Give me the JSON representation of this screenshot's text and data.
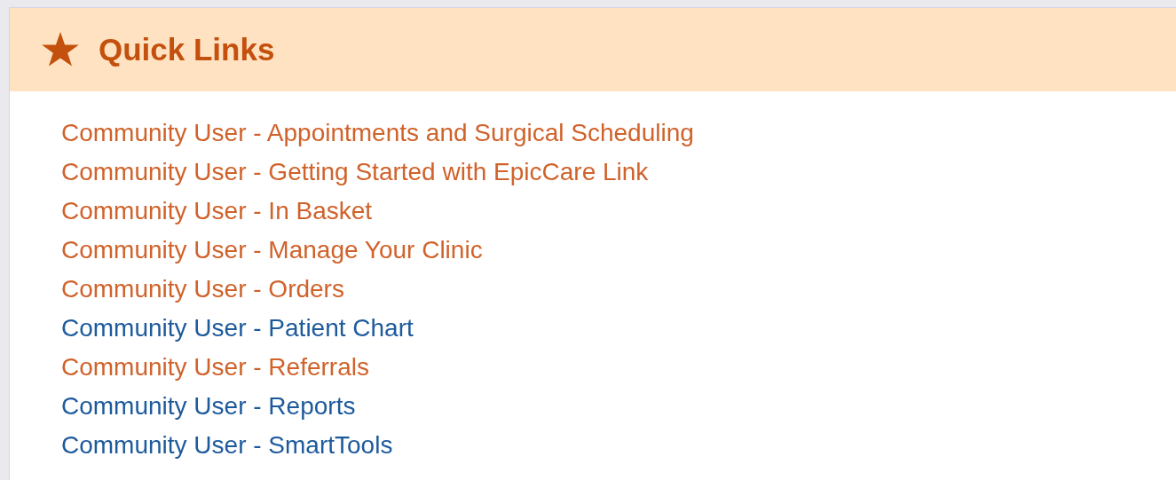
{
  "panel": {
    "title": "Quick Links"
  },
  "links": [
    {
      "label": "Community User - Appointments and Surgical Scheduling",
      "visited": false
    },
    {
      "label": "Community User - Getting Started with EpicCare Link",
      "visited": false
    },
    {
      "label": "Community User - In Basket",
      "visited": false
    },
    {
      "label": "Community User - Manage Your Clinic",
      "visited": false
    },
    {
      "label": "Community User - Orders",
      "visited": false
    },
    {
      "label": "Community User - Patient Chart",
      "visited": true
    },
    {
      "label": "Community User - Referrals",
      "visited": false
    },
    {
      "label": "Community User - Reports",
      "visited": true
    },
    {
      "label": "Community User - SmartTools",
      "visited": true
    }
  ]
}
